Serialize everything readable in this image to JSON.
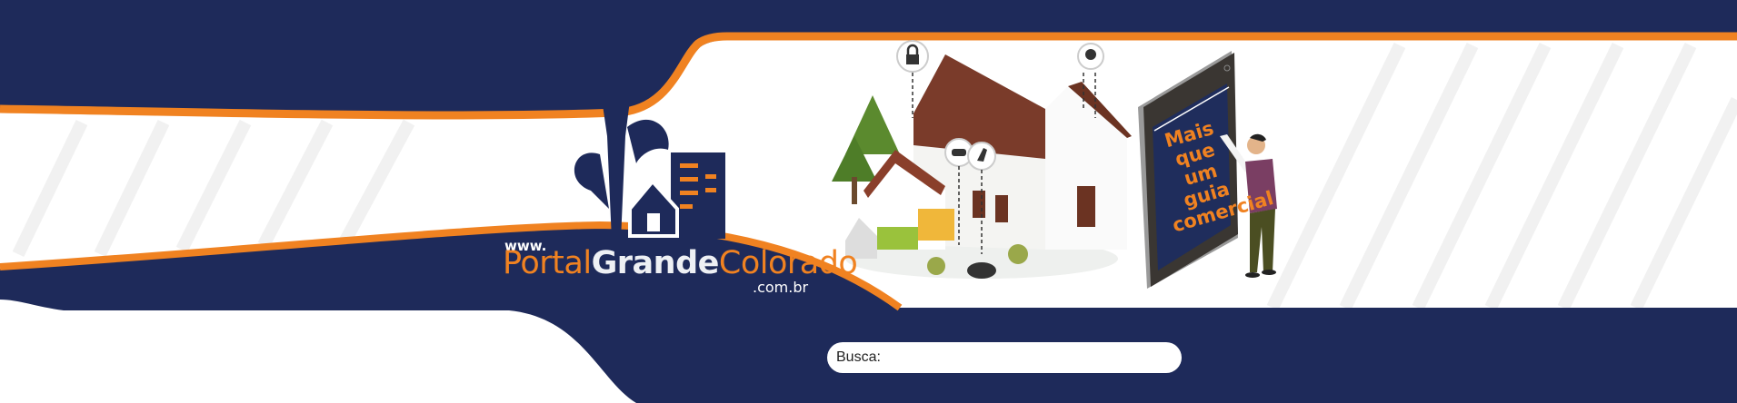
{
  "colors": {
    "navy": "#1e2a5a",
    "orange": "#f08221",
    "white": "#ffffff",
    "screen": "#1f2d5c"
  },
  "logo": {
    "prefix": "www.",
    "part1": "Portal",
    "part2": "Grande",
    "part3": "Colorado",
    "suffix": ".com.br"
  },
  "illustration": {
    "phone_lines": [
      "Mais",
      "que",
      "um",
      "guia",
      "comercial"
    ],
    "icons": [
      "lock-icon",
      "car-icon",
      "bird-icon",
      "lightbulb-icon"
    ]
  },
  "search": {
    "label": "Busca:",
    "value": ""
  }
}
